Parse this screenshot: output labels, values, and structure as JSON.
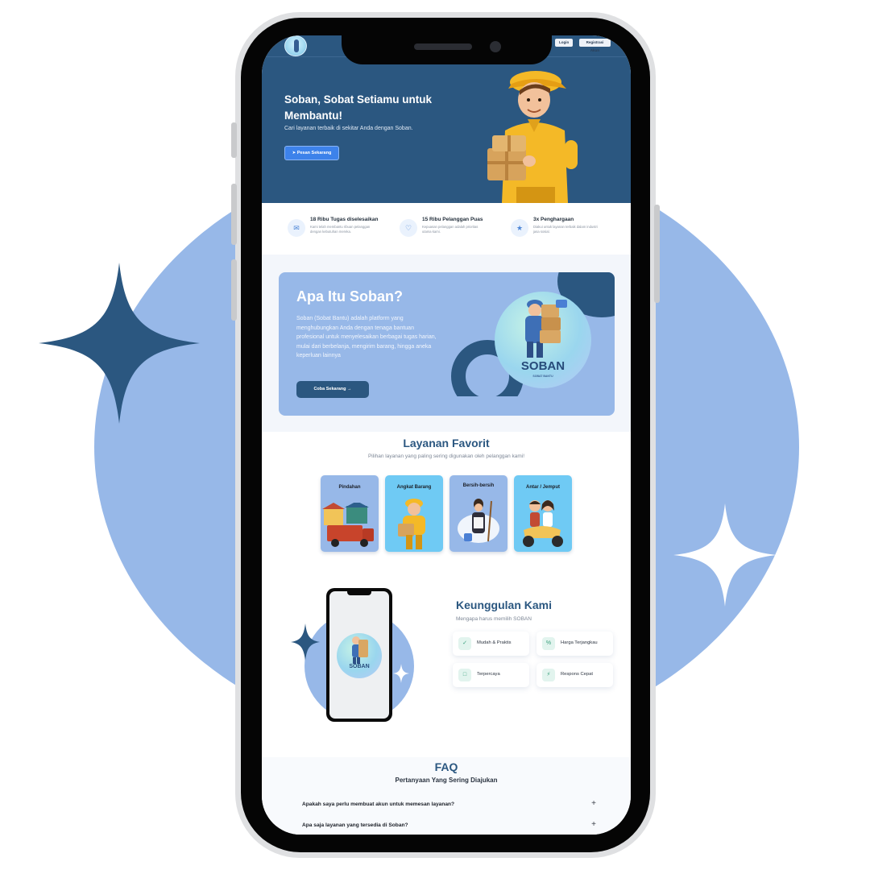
{
  "nav": {
    "login_label": "Login",
    "register_label": "Registrasi Akun"
  },
  "hero": {
    "title": "Soban, Sobat Setiamu untuk Membantu!",
    "subtitle": "Cari layanan terbaik di sekitar Anda dengan Soban.",
    "cta_label": "Pesan Sekarang"
  },
  "stats": [
    {
      "icon": "mail-icon",
      "title": "18 Ribu Tugas diselesaikan",
      "desc": "Kami telah membantu ribuan pelanggan dengan kebutuhan mereka."
    },
    {
      "icon": "heart-hands-icon",
      "title": "15 Ribu Pelanggan Puas",
      "desc": "Kepuasan pelanggan adalah prioritas utama kami."
    },
    {
      "icon": "trophy-icon",
      "title": "3x Penghargaan",
      "desc": "Diakui untuk layanan terbaik dalam industri jasa sosial."
    }
  ],
  "about": {
    "title": "Apa Itu Soban?",
    "text": "Soban (Sobat Bantu) adalah platform yang menghubungkan Anda dengan tenaga bantuan profesional untuk menyelesaikan berbagai tugas harian, mulai dari berbelanja, mengirim barang, hingga aneka keperluan lainnya",
    "cta_label": "Coba Sekarang",
    "brand": "SOBAN",
    "brand_sub": "SOBAT BANTU"
  },
  "favorites": {
    "title": "Layanan Favorit",
    "subtitle": "Pilihan layanan yang paling sering digunakan oleh pelanggan kami!",
    "items": [
      {
        "label": "Pindahan"
      },
      {
        "label": "Angkat Barang"
      },
      {
        "label": "Bersih-bersih"
      },
      {
        "label": "Antar / Jemput"
      }
    ]
  },
  "advantages": {
    "title": "Keunggulan Kami",
    "subtitle": "Mengapa harus memilih SOBAN",
    "items": [
      {
        "label": "Mudah & Praktis"
      },
      {
        "label": "Harga Terjangkau"
      },
      {
        "label": "Terpercaya"
      },
      {
        "label": "Respons Cepat"
      }
    ],
    "mockup_brand": "SOBAN"
  },
  "faq": {
    "title": "FAQ",
    "subtitle": "Pertanyaan Yang Sering Diajukan",
    "items": [
      {
        "question": "Apakah saya perlu membuat akun untuk memesan layanan?",
        "toggle": "+"
      },
      {
        "question": "Apa saja layanan yang tersedia di Soban?",
        "toggle": "+"
      }
    ]
  },
  "colors": {
    "brand_dark": "#2b5780",
    "brand_light": "#97b8e8",
    "accent_blue": "#3d82ea",
    "card_cyan": "#6fcaf4"
  }
}
